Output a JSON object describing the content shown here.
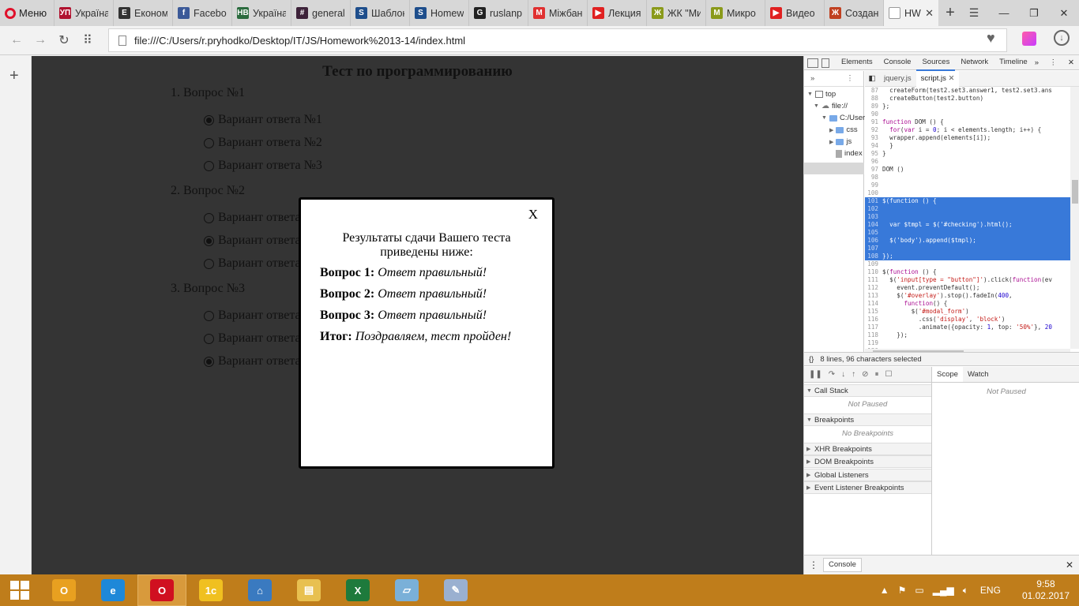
{
  "browser": {
    "menu_label": "Меню",
    "tabs": [
      {
        "title": "Україна",
        "icon": "ukrpravda-icon",
        "color": "#b0122f",
        "glyph": "УП"
      },
      {
        "title": "Економ",
        "icon": "epravda-icon",
        "color": "#333333",
        "glyph": "Е"
      },
      {
        "title": "Facebook",
        "icon": "facebook-icon",
        "color": "#3b5998",
        "glyph": "f"
      },
      {
        "title": "Україна",
        "icon": "nv-icon",
        "color": "#2b6b3e",
        "glyph": "НВ"
      },
      {
        "title": "general",
        "icon": "slack-icon",
        "color": "#3d2239",
        "glyph": "#"
      },
      {
        "title": "Шаблон",
        "icon": "skype-icon",
        "color": "#1e4e8c",
        "glyph": "S"
      },
      {
        "title": "Homew",
        "icon": "skype-icon",
        "color": "#1e4e8c",
        "glyph": "S"
      },
      {
        "title": "ruslanp",
        "icon": "github-icon",
        "color": "#222222",
        "glyph": "G"
      },
      {
        "title": "Міжбан",
        "icon": "minfin-icon",
        "color": "#e03030",
        "glyph": "M"
      },
      {
        "title": "Лекция",
        "icon": "youtube-icon",
        "color": "#e02020",
        "glyph": "▶"
      },
      {
        "title": "ЖК \"Ми",
        "icon": "lun-icon",
        "color": "#8a9a1a",
        "glyph": "Ж"
      },
      {
        "title": "Микро",
        "icon": "lun-icon",
        "color": "#8a9a1a",
        "glyph": "М"
      },
      {
        "title": "Видео",
        "icon": "youtube-icon",
        "color": "#e02020",
        "glyph": "▶"
      },
      {
        "title": "Создан",
        "icon": "ymoney-icon",
        "color": "#c04020",
        "glyph": "Ж"
      }
    ],
    "active_tab": {
      "title": "HW"
    },
    "url": "file:///C:/Users/r.pryhodko/Desktop/IT/JS/Homework%2013-14/index.html"
  },
  "page": {
    "title": "Тест по программированию",
    "questions": [
      {
        "label": "1. Вопрос №1",
        "answers": [
          {
            "text": "Вариант ответа №1",
            "checked": true
          },
          {
            "text": "Вариант ответа №2",
            "checked": false
          },
          {
            "text": "Вариант ответа №3",
            "checked": false
          }
        ]
      },
      {
        "label": "2. Вопрос №2",
        "answers": [
          {
            "text": "Вариант ответа №1",
            "checked": false
          },
          {
            "text": "Вариант ответа №2",
            "checked": true
          },
          {
            "text": "Вариант ответа №3",
            "checked": false
          }
        ]
      },
      {
        "label": "3. Вопрос №3",
        "answers": [
          {
            "text": "Вариант ответа №1",
            "checked": false
          },
          {
            "text": "Вариант ответа №2",
            "checked": false
          },
          {
            "text": "Вариант ответа №3",
            "checked": true
          }
        ]
      }
    ],
    "modal": {
      "close_label": "X",
      "intro": "Результаты сдачи Вашего теста приведены ниже:",
      "results": [
        {
          "label": "Вопрос 1:",
          "value": "Ответ правильный!"
        },
        {
          "label": "Вопрос 2:",
          "value": "Ответ правильный!"
        },
        {
          "label": "Вопрос 3:",
          "value": "Ответ правильный!"
        },
        {
          "label": "Итог:",
          "value": "Поздравляем, тест пройден!"
        }
      ]
    }
  },
  "devtools": {
    "panels": [
      "Elements",
      "Console",
      "Sources",
      "Network",
      "Timeline"
    ],
    "active_panel": "Sources",
    "tree": [
      "top",
      "file://",
      "C:/User",
      "css",
      "js",
      "index"
    ],
    "file_tabs": [
      "jquery.js",
      "script.js"
    ],
    "active_file": "script.js",
    "code_lines": [
      {
        "n": "87",
        "code": "  createForm(test2.set3.answer1, test2.set3.ans",
        "sel": false
      },
      {
        "n": "88",
        "code": "  createButton(test2.button)",
        "sel": false
      },
      {
        "n": "89",
        "code": "};",
        "sel": false
      },
      {
        "n": "90",
        "code": "",
        "sel": false
      },
      {
        "n": "91",
        "code": "function DOM () {",
        "sel": false
      },
      {
        "n": "92",
        "code": "  for(var i = 0; i < elements.length; i++) {",
        "sel": false
      },
      {
        "n": "93",
        "code": "  wrapper.append(elements[i]);",
        "sel": false
      },
      {
        "n": "94",
        "code": "  }",
        "sel": false
      },
      {
        "n": "95",
        "code": "}",
        "sel": false
      },
      {
        "n": "96",
        "code": "",
        "sel": false
      },
      {
        "n": "97",
        "code": "DOM ()",
        "sel": false
      },
      {
        "n": "98",
        "code": "",
        "sel": false
      },
      {
        "n": "99",
        "code": "",
        "sel": false
      },
      {
        "n": "100",
        "code": "",
        "sel": false
      },
      {
        "n": "101",
        "code": "$(function () {",
        "sel": true
      },
      {
        "n": "102",
        "code": "",
        "sel": true
      },
      {
        "n": "103",
        "code": "",
        "sel": true
      },
      {
        "n": "104",
        "code": "  var $tmpl = $('#checking').html();",
        "sel": true
      },
      {
        "n": "105",
        "code": "",
        "sel": true
      },
      {
        "n": "106",
        "code": "  $('body').append($tmpl);",
        "sel": true
      },
      {
        "n": "107",
        "code": "",
        "sel": true
      },
      {
        "n": "108",
        "code": "});",
        "sel": true
      },
      {
        "n": "109",
        "code": "",
        "sel": false
      },
      {
        "n": "110",
        "code": "$(function () {",
        "sel": false
      },
      {
        "n": "111",
        "code": "  $('input[type = \"button\"]').click(function(ev",
        "sel": false
      },
      {
        "n": "112",
        "code": "    event.preventDefault();",
        "sel": false
      },
      {
        "n": "113",
        "code": "    $('#overlay').stop().fadeIn(400,",
        "sel": false
      },
      {
        "n": "114",
        "code": "      function() {",
        "sel": false
      },
      {
        "n": "115",
        "code": "        $('#modal_form')",
        "sel": false
      },
      {
        "n": "116",
        "code": "          .css('display', 'block')",
        "sel": false
      },
      {
        "n": "117",
        "code": "          .animate({opacity: 1, top: '50%'}, 20",
        "sel": false
      },
      {
        "n": "118",
        "code": "    });",
        "sel": false
      },
      {
        "n": "119",
        "code": "",
        "sel": false
      },
      {
        "n": "120",
        "code": "",
        "sel": false
      }
    ],
    "status_text": "8 lines, 96 characters selected",
    "scope_tabs": [
      "Scope",
      "Watch"
    ],
    "not_paused": "Not Paused",
    "call_stack": "Call Stack",
    "breakpoints": "Breakpoints",
    "no_breakpoints": "No Breakpoints",
    "xhr_breakpoints": "XHR Breakpoints",
    "dom_breakpoints": "DOM Breakpoints",
    "global_listeners": "Global Listeners",
    "event_listener_breakpoints": "Event Listener Breakpoints",
    "console_tab": "Console"
  },
  "taskbar": {
    "apps": [
      {
        "name": "outlook-icon",
        "color": "#e8a020",
        "glyph": "O"
      },
      {
        "name": "ie-icon",
        "color": "#1e88d8",
        "glyph": "e"
      },
      {
        "name": "opera-icon",
        "color": "#d01020",
        "glyph": "O"
      },
      {
        "name": "1c-icon",
        "color": "#f0c020",
        "glyph": "1с"
      },
      {
        "name": "app-icon",
        "color": "#3a7ac0",
        "glyph": "⌂"
      },
      {
        "name": "explorer-icon",
        "color": "#e8c050",
        "glyph": "▤"
      },
      {
        "name": "excel-icon",
        "color": "#1e7a3c",
        "glyph": "X"
      },
      {
        "name": "notes-icon",
        "color": "#7ab0d8",
        "glyph": "▱"
      },
      {
        "name": "paint-icon",
        "color": "#9ab0d0",
        "glyph": "✎"
      }
    ],
    "lang": "ENG",
    "time": "9:58",
    "date": "01.02.2017"
  }
}
